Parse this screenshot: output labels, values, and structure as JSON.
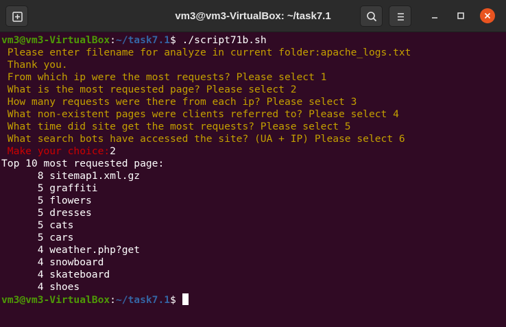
{
  "window": {
    "title": "vm3@vm3-VirtualBox: ~/task7.1",
    "icons": [
      "new-tab-icon",
      "search-icon",
      "hamburger-menu-icon",
      "minimize-icon",
      "maximize-icon",
      "close-icon"
    ]
  },
  "colors": {
    "background": "#300a24",
    "prompt_user": "#4e9a06",
    "prompt_path": "#3465a4",
    "yellow_text": "#c4a000",
    "red_text": "#cc0000",
    "close_button": "#e95420"
  },
  "prompt": {
    "user_host": "vm3@vm3-VirtualBox",
    "sep": ":",
    "path": "~/task7.1",
    "symbol": "$ "
  },
  "session": {
    "command": "./script71b.sh",
    "filename_prompt": " Please enter filename for analyze in current folder:",
    "filename_value": "apache_logs.txt",
    "thanks": " Thank you.",
    "menu": [
      " From which ip were the most requests? Please select 1",
      " What is the most requested page? Please select 2",
      " How many requests were there from each ip? Please select 3",
      " What non-existent pages were clients referred to? Please select 4",
      " What time did site get the most requests? Please select 5",
      " What search bots have accessed the site? (UA + IP) Please select 6"
    ],
    "choice_prompt": " Make your choice:",
    "choice_value": "2",
    "result_header": "Top 10 most requested page:",
    "results": [
      "      8 sitemap1.xml.gz",
      "      5 graffiti",
      "      5 flowers",
      "      5 dresses",
      "      5 cats",
      "      5 cars",
      "      4 weather.php?get",
      "      4 snowboard",
      "      4 skateboard",
      "      4 shoes"
    ]
  }
}
